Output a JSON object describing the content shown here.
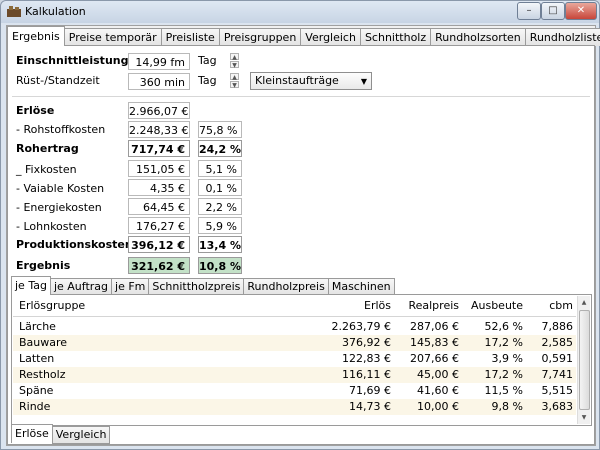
{
  "window": {
    "title": "Kalkulation",
    "min": "–",
    "max": "□",
    "close": "✕"
  },
  "main_tabs": [
    "Ergebnis",
    "Preise temporär",
    "Preisliste",
    "Preisgruppen",
    "Vergleich",
    "Schnittholz",
    "Rundholzsorten",
    "Rundholzlisten"
  ],
  "form": {
    "einschnitt_label": "Einschnittleistung",
    "einschnitt_value": "14,99 fm",
    "einschnitt_unit": "Tag",
    "ruest_label": "Rüst-/Standzeit",
    "ruest_value": "360 min",
    "ruest_unit": "Tag",
    "order_select": "Kleinstaufträge"
  },
  "calc": {
    "erloese_label": "Erlöse",
    "erloese_value": "2.966,07 €",
    "rohstoff_label": "-  Rohstoffkosten",
    "rohstoff_value": "2.248,33 €",
    "rohstoff_pct": "75,8 %",
    "rohertrag_label": "Rohertrag",
    "rohertrag_value": "717,74 €",
    "rohertrag_pct": "24,2 %",
    "fix_label": "_  Fixkosten",
    "fix_value": "151,05 €",
    "fix_pct": "5,1 %",
    "var_label": "-  Vaiable Kosten",
    "var_value": "4,35 €",
    "var_pct": "0,1 %",
    "energie_label": "-  Energiekosten",
    "energie_value": "64,45 €",
    "energie_pct": "2,2 %",
    "lohn_label": "-  Lohnkosten",
    "lohn_value": "176,27 €",
    "lohn_pct": "5,9 %",
    "prod_label": "Produktionskosten",
    "prod_value": "396,12 €",
    "prod_pct": "13,4 %",
    "ergebnis_label": "Ergebnis",
    "ergebnis_value": "321,62 €",
    "ergebnis_pct": "10,8 %"
  },
  "sub_tabs": [
    "je Tag",
    "je Auftrag",
    "je Fm",
    "Schnittholzpreis",
    "Rundholzpreis",
    "Maschinen"
  ],
  "table": {
    "headers": [
      "Erlösgruppe",
      "Erlös",
      "Realpreis",
      "Ausbeute",
      "cbm"
    ],
    "rows": [
      [
        "Lärche",
        "2.263,79 €",
        "287,06 €",
        "52,6 %",
        "7,886"
      ],
      [
        "Bauware",
        "376,92 €",
        "145,83 €",
        "17,2 %",
        "2,585"
      ],
      [
        "Latten",
        "122,83 €",
        "207,66 €",
        "3,9 %",
        "0,591"
      ],
      [
        "Restholz",
        "116,11 €",
        "45,00 €",
        "17,2 %",
        "7,741"
      ],
      [
        "Späne",
        "71,69 €",
        "41,60 €",
        "11,5 %",
        "5,515"
      ],
      [
        "Rinde",
        "14,73 €",
        "10,00 €",
        "9,8 %",
        "3,683"
      ]
    ]
  },
  "footer_tabs": [
    "Erlöse",
    "Vergleich"
  ]
}
